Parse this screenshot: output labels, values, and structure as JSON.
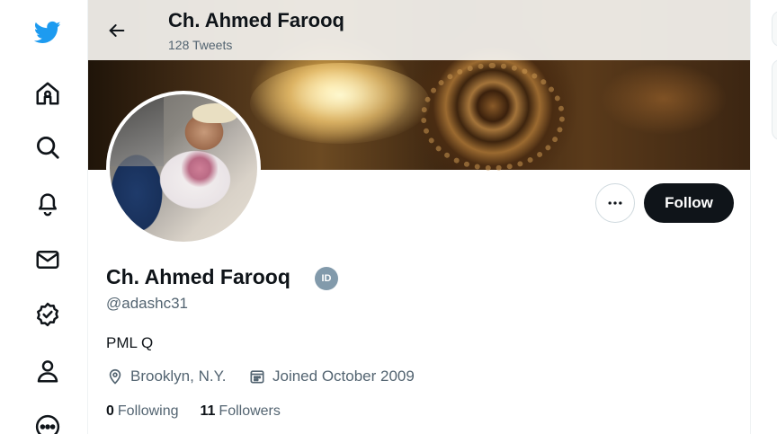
{
  "colors": {
    "twitter_blue": "#1d9bf0",
    "text_primary": "#0f1419",
    "text_secondary": "#536471",
    "follow_bg": "#0f1419",
    "badge_gray": "#829aab"
  },
  "nav": {
    "icons": [
      "twitter-logo-icon",
      "home-icon",
      "search-icon",
      "notifications-bell-icon",
      "messages-envelope-icon",
      "verified-badge-icon",
      "profile-person-icon",
      "more-circle-icon"
    ]
  },
  "header": {
    "name": "Ch. Ahmed Farooq",
    "tweets_count": "128 Tweets"
  },
  "profile": {
    "display_name": "Ch. Ahmed Farooq",
    "id_badge": "ID",
    "handle": "@adashc31",
    "bio": "PML Q",
    "location": "Brooklyn, N.Y.",
    "joined": "Joined October 2009",
    "following_count": "0",
    "following_label": "Following",
    "followers_count": "11",
    "followers_label": "Followers"
  },
  "actions": {
    "follow_label": "Follow",
    "more_icon": "more-ellipsis-icon"
  }
}
